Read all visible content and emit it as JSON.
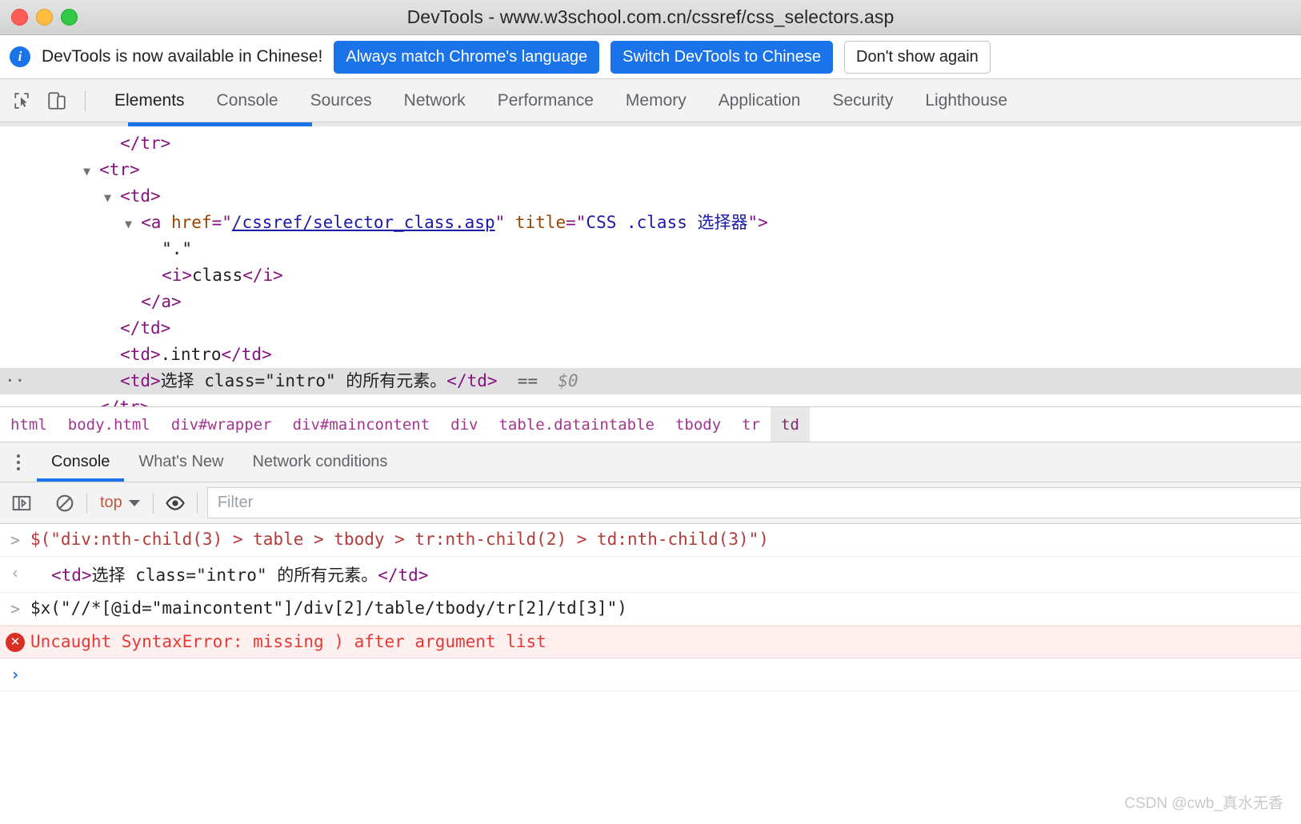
{
  "window": {
    "title": "DevTools - www.w3school.com.cn/cssref/css_selectors.asp"
  },
  "notice": {
    "icon": "info-icon",
    "message": "DevTools is now available in Chinese!",
    "primary_button": "Always match Chrome's language",
    "secondary_button": "Switch DevTools to Chinese",
    "dismiss_button": "Don't show again",
    "accent_color": "#1a73e8"
  },
  "main_tabs": {
    "icons": [
      "inspect-element-icon",
      "device-toolbar-icon"
    ],
    "items": [
      {
        "label": "Elements",
        "active": true
      },
      {
        "label": "Console",
        "active": false
      },
      {
        "label": "Sources",
        "active": false
      },
      {
        "label": "Network",
        "active": false
      },
      {
        "label": "Performance",
        "active": false
      },
      {
        "label": "Memory",
        "active": false
      },
      {
        "label": "Application",
        "active": false
      },
      {
        "label": "Security",
        "active": false
      },
      {
        "label": "Lighthouse",
        "active": false
      }
    ]
  },
  "dom_tree": {
    "lines": [
      {
        "id": "l1",
        "indent": 5,
        "twisty": "",
        "selected": false,
        "gutter": "",
        "parts": [
          {
            "t": "tag",
            "s": "</tr>"
          }
        ]
      },
      {
        "id": "l2",
        "indent": 4,
        "twisty": "▼",
        "selected": false,
        "gutter": "",
        "parts": [
          {
            "t": "tag",
            "s": "<tr>"
          }
        ]
      },
      {
        "id": "l3",
        "indent": 5,
        "twisty": "▼",
        "selected": false,
        "gutter": "",
        "parts": [
          {
            "t": "tag",
            "s": "<td>"
          }
        ]
      },
      {
        "id": "l4",
        "indent": 6,
        "twisty": "▼",
        "selected": false,
        "gutter": "",
        "parts": [
          {
            "t": "tag",
            "s": "<a "
          },
          {
            "t": "attr",
            "s": "href"
          },
          {
            "t": "tag",
            "s": "=\""
          },
          {
            "t": "link",
            "s": "/cssref/selector_class.asp"
          },
          {
            "t": "tag",
            "s": "\" "
          },
          {
            "t": "attr",
            "s": "title"
          },
          {
            "t": "tag",
            "s": "=\""
          },
          {
            "t": "val",
            "s": "CSS .class 选择器"
          },
          {
            "t": "tag",
            "s": "\">"
          }
        ]
      },
      {
        "id": "l5",
        "indent": 7,
        "twisty": "",
        "selected": false,
        "gutter": "",
        "parts": [
          {
            "t": "txt",
            "s": "\".\""
          }
        ]
      },
      {
        "id": "l6",
        "indent": 7,
        "twisty": "",
        "selected": false,
        "gutter": "",
        "parts": [
          {
            "t": "tag",
            "s": "<i>"
          },
          {
            "t": "txt",
            "s": "class"
          },
          {
            "t": "tag",
            "s": "</i>"
          }
        ]
      },
      {
        "id": "l7",
        "indent": 6,
        "twisty": "",
        "selected": false,
        "gutter": "",
        "parts": [
          {
            "t": "tag",
            "s": "</a>"
          }
        ]
      },
      {
        "id": "l8",
        "indent": 5,
        "twisty": "",
        "selected": false,
        "gutter": "",
        "parts": [
          {
            "t": "tag",
            "s": "</td>"
          }
        ]
      },
      {
        "id": "l9",
        "indent": 5,
        "twisty": "",
        "selected": false,
        "gutter": "",
        "parts": [
          {
            "t": "tag",
            "s": "<td>"
          },
          {
            "t": "txt",
            "s": ".intro"
          },
          {
            "t": "tag",
            "s": "</td>"
          }
        ]
      },
      {
        "id": "l10",
        "indent": 5,
        "twisty": "",
        "selected": true,
        "gutter": "··",
        "parts": [
          {
            "t": "tag",
            "s": "<td>"
          },
          {
            "t": "txt",
            "s": "选择 class=\"intro\" 的所有元素。"
          },
          {
            "t": "tag",
            "s": "</td>"
          },
          {
            "t": "eqeq",
            "s": "  ==  "
          },
          {
            "t": "dollar0",
            "s": "$0"
          }
        ]
      },
      {
        "id": "l11",
        "indent": 4,
        "twisty": "",
        "selected": false,
        "gutter": "",
        "parts": [
          {
            "t": "tag",
            "s": "</tr>"
          }
        ]
      }
    ]
  },
  "breadcrumb": {
    "items": [
      {
        "label": "html",
        "selected": false
      },
      {
        "label": "body.html",
        "selected": false
      },
      {
        "label": "div#wrapper",
        "selected": false
      },
      {
        "label": "div#maincontent",
        "selected": false
      },
      {
        "label": "div",
        "selected": false
      },
      {
        "label": "table.dataintable",
        "selected": false
      },
      {
        "label": "tbody",
        "selected": false
      },
      {
        "label": "tr",
        "selected": false
      },
      {
        "label": "td",
        "selected": true
      }
    ]
  },
  "drawer": {
    "menu_icon": "kebab-menu-icon",
    "tabs": [
      {
        "label": "Console",
        "active": true
      },
      {
        "label": "What's New",
        "active": false
      },
      {
        "label": "Network conditions",
        "active": false
      }
    ]
  },
  "console_toolbar": {
    "sidebar_icon": "console-sidebar-icon",
    "clear_icon": "clear-console-icon",
    "context": "top",
    "context_caret": "chevron-down-icon",
    "eye_icon": "live-expression-eye-icon",
    "filter_placeholder": "Filter"
  },
  "console": {
    "entries": [
      {
        "id": "e1",
        "kind": "input",
        "arrow": ">",
        "text": "$(\"div:nth-child(3) > table > tbody > tr:nth-child(2) > td:nth-child(3)\")"
      },
      {
        "id": "e2",
        "kind": "output",
        "arrow": "‹",
        "parts": [
          {
            "t": "tag",
            "s": "<td>"
          },
          {
            "t": "txt",
            "s": "选择 class=\"intro\" 的所有元素。"
          },
          {
            "t": "tag",
            "s": "</td>"
          }
        ]
      },
      {
        "id": "e3",
        "kind": "input-dark",
        "arrow": ">",
        "text": "$x(\"//*[@id=\"maincontent\"]/div[2]/table/tbody/tr[2]/td[3]\")"
      },
      {
        "id": "e4",
        "kind": "error",
        "arrow": "✕",
        "text": "Uncaught SyntaxError: missing ) after argument list"
      },
      {
        "id": "e5",
        "kind": "prompt",
        "arrow": "›",
        "text": ""
      }
    ]
  },
  "watermark": {
    "text": "CSDN @cwb_真水无香"
  }
}
